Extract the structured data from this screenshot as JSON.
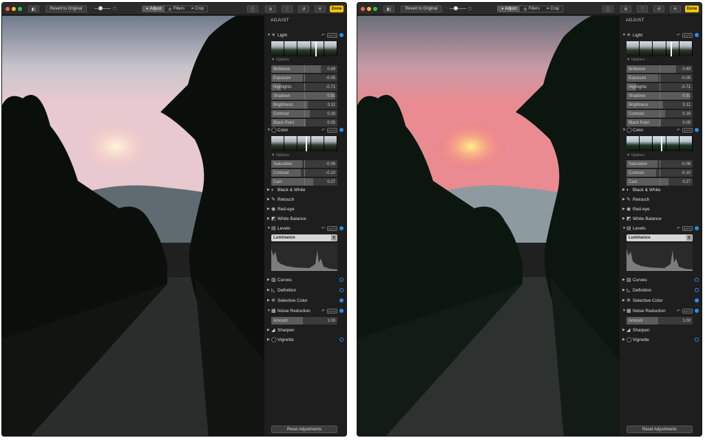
{
  "toolbar": {
    "revert_label": "Revert to Original",
    "tabs": [
      {
        "label": "Adjust",
        "icon": "adjust-icon"
      },
      {
        "label": "Filters",
        "icon": "filters-icon"
      },
      {
        "label": "Crop",
        "icon": "crop-icon"
      }
    ],
    "done_label": "Done"
  },
  "panel": {
    "title": "ADJUST",
    "options_label": "Options",
    "auto_label": "AUTO",
    "light": {
      "label": "Light",
      "sliders": [
        {
          "label": "Brilliance",
          "value": "0.49"
        },
        {
          "label": "Exposure",
          "value": "-0.05"
        },
        {
          "label": "Highlights",
          "value": "-0.71"
        },
        {
          "label": "Shadows",
          "value": "0.91"
        },
        {
          "label": "Brightness",
          "value": "0.11"
        },
        {
          "label": "Contrast",
          "value": "0.16"
        },
        {
          "label": "Black Point",
          "value": "0.05"
        }
      ]
    },
    "color": {
      "label": "Color",
      "sliders": [
        {
          "label": "Saturation",
          "value": "-0.06"
        },
        {
          "label": "Contrast",
          "value": "-0.10"
        },
        {
          "label": "Cast",
          "value": "0.27"
        }
      ]
    },
    "sections_a": [
      "Black & White",
      "Retouch",
      "Red-eye",
      "White Balance"
    ],
    "levels": {
      "label": "Levels",
      "dropdown": "Luminance"
    },
    "sections_b": [
      "Curves",
      "Definition",
      "Selective Color"
    ],
    "noise": {
      "label": "Noise Reduction",
      "amount_label": "Amount",
      "amount_value": "1.00"
    },
    "sections_c": [
      "Sharpen",
      "Vignette"
    ],
    "reset_label": "Reset Adjustments"
  },
  "colors": {
    "accent": "#2a8cf0",
    "done": "#f5c400"
  }
}
